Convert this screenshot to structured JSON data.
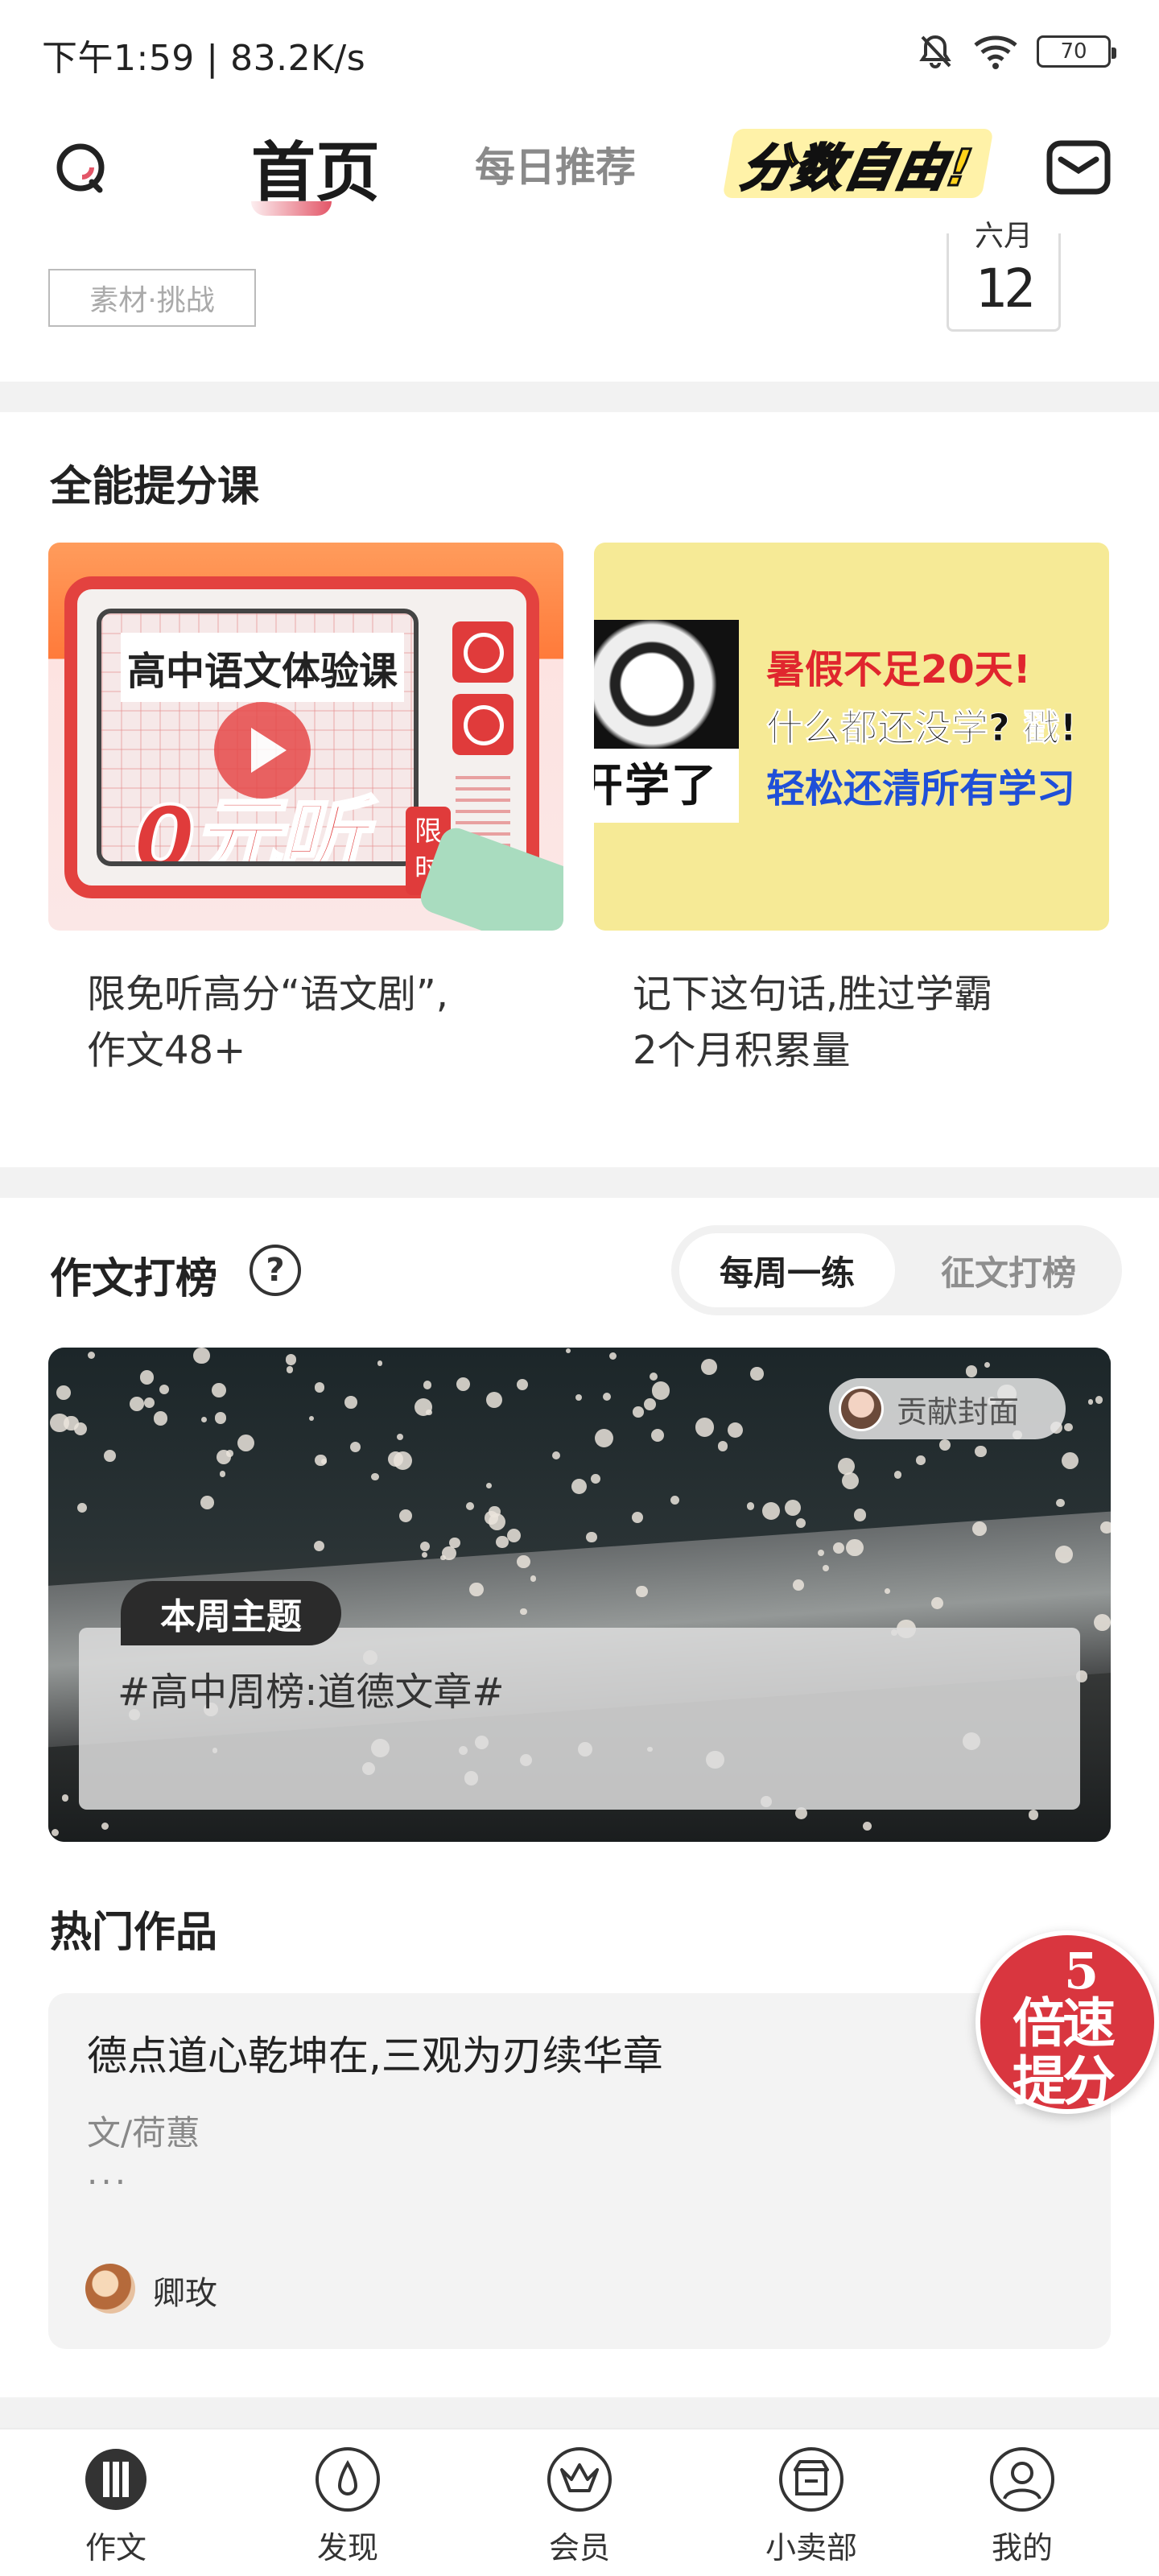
{
  "status_bar": {
    "text": "下午1:59 | 83.2K/s",
    "battery": "70",
    "icons": [
      "bell-muted-icon",
      "wifi-icon",
      "battery-icon"
    ]
  },
  "top_nav": {
    "home": "首页",
    "daily": "每日推荐",
    "free_banner": "分数自由!",
    "icons": [
      "search-icon",
      "mail-icon"
    ]
  },
  "top_card": {
    "tag": "素材·挑战",
    "month": "六月",
    "day": "12"
  },
  "courses": {
    "title": "全能提分课",
    "items": [
      {
        "image_heading": "高中语文体验课",
        "image_badge": "0元听",
        "image_limit_1": "限",
        "image_limit_2": "时",
        "title_line1": "限免听高分“语文剧”,",
        "title_line2": "作文48+"
      },
      {
        "image_meme_text": "开学了",
        "image_line1": "暑假不足20天!",
        "image_line2": "什么都还没学? 戳!",
        "image_line3": "轻松还清所有学习",
        "title_line1": "记下这句话,胜过学霸",
        "title_line2": "2个月积累量"
      }
    ]
  },
  "ranking": {
    "title": "作文打榜",
    "help": "?",
    "tabs": [
      "每周一练",
      "征文打榜"
    ],
    "banner": {
      "contributor": "贡献封面",
      "theme_tag": "本周主题",
      "theme": "#高中周榜:道德文章#"
    }
  },
  "hot_works": {
    "title": "热门作品",
    "item": {
      "title": "德点道心乾坤在,三观为刃续华章",
      "author": "文/荷蕙",
      "excerpt": "...",
      "user": "卿玫"
    }
  },
  "speed_badge": {
    "number": "5",
    "line1": "倍速",
    "line2": "提分"
  },
  "tab_bar": {
    "items": [
      "作文",
      "发现",
      "会员",
      "小卖部",
      "我的"
    ]
  },
  "colors": {
    "accent": "#d9363f",
    "divider": "#f2f2f2"
  }
}
